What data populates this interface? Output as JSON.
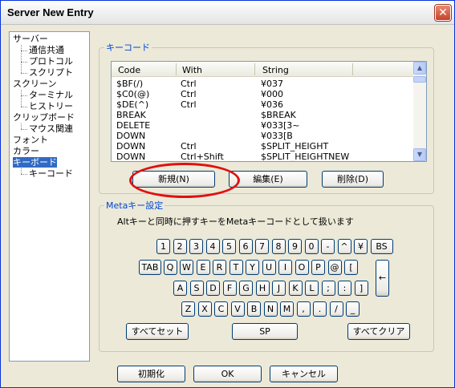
{
  "window": {
    "title": "Server New Entry"
  },
  "tree": [
    {
      "label": "サーバー",
      "level": 0,
      "selected": false
    },
    {
      "label": "通信共通",
      "level": 1,
      "selected": false
    },
    {
      "label": "プロトコル",
      "level": 1,
      "selected": false
    },
    {
      "label": "スクリプト",
      "level": 1,
      "selected": false
    },
    {
      "label": "スクリーン",
      "level": 0,
      "selected": false
    },
    {
      "label": "ターミナル",
      "level": 1,
      "selected": false
    },
    {
      "label": "ヒストリー",
      "level": 1,
      "selected": false
    },
    {
      "label": "クリップボード",
      "level": 0,
      "selected": false
    },
    {
      "label": "マウス関連",
      "level": 1,
      "selected": false
    },
    {
      "label": "フォント",
      "level": 0,
      "selected": false
    },
    {
      "label": "カラー",
      "level": 0,
      "selected": false
    },
    {
      "label": "キーボード",
      "level": 0,
      "selected": true
    },
    {
      "label": "キーコード",
      "level": 1,
      "selected": false
    }
  ],
  "keycode_group": {
    "legend": "キーコード",
    "columns": [
      "Code",
      "With",
      "String"
    ],
    "rows": [
      {
        "code": "$BF(/)",
        "with": "Ctrl",
        "string": "¥037"
      },
      {
        "code": "$C0(@)",
        "with": "Ctrl",
        "string": "¥000"
      },
      {
        "code": "$DE(^)",
        "with": "Ctrl",
        "string": "¥036"
      },
      {
        "code": "BREAK",
        "with": "",
        "string": "$BREAK"
      },
      {
        "code": "DELETE",
        "with": "",
        "string": "¥033[3~"
      },
      {
        "code": "DOWN",
        "with": "",
        "string": "¥033[B"
      },
      {
        "code": "DOWN",
        "with": "Ctrl",
        "string": "$SPLIT_HEIGHT"
      },
      {
        "code": "DOWN",
        "with": "Ctrl+Shift",
        "string": "$SPLIT_HEIGHTNEW"
      }
    ],
    "buttons": {
      "new": "新規(N)",
      "edit": "編集(E)",
      "delete": "削除(D)"
    }
  },
  "meta_group": {
    "legend": "Metaキー設定",
    "description": "Altキーと同時に押すキーをMetaキーコードとして扱います",
    "keys": {
      "row1": [
        "1",
        "2",
        "3",
        "4",
        "5",
        "6",
        "7",
        "8",
        "9",
        "0",
        "-",
        "^",
        "¥",
        "BS"
      ],
      "row2": [
        "TAB",
        "Q",
        "W",
        "E",
        "R",
        "T",
        "Y",
        "U",
        "I",
        "O",
        "P",
        "@",
        "["
      ],
      "row3": [
        "A",
        "S",
        "D",
        "F",
        "G",
        "H",
        "J",
        "K",
        "L",
        ";",
        ":",
        "]"
      ],
      "row4": [
        "Z",
        "X",
        "C",
        "V",
        "B",
        "N",
        "M",
        ",",
        ".",
        "/",
        "_"
      ],
      "enter": "←"
    },
    "buttons": {
      "set_all": "すべてセット",
      "space": "SP",
      "clear_all": "すべてクリア"
    }
  },
  "footer": {
    "init": "初期化",
    "ok": "OK",
    "cancel": "キャンセル"
  },
  "colors": {
    "selection": "#316ac5",
    "legend": "#0046d5",
    "highlight_oval": "#e01010"
  }
}
